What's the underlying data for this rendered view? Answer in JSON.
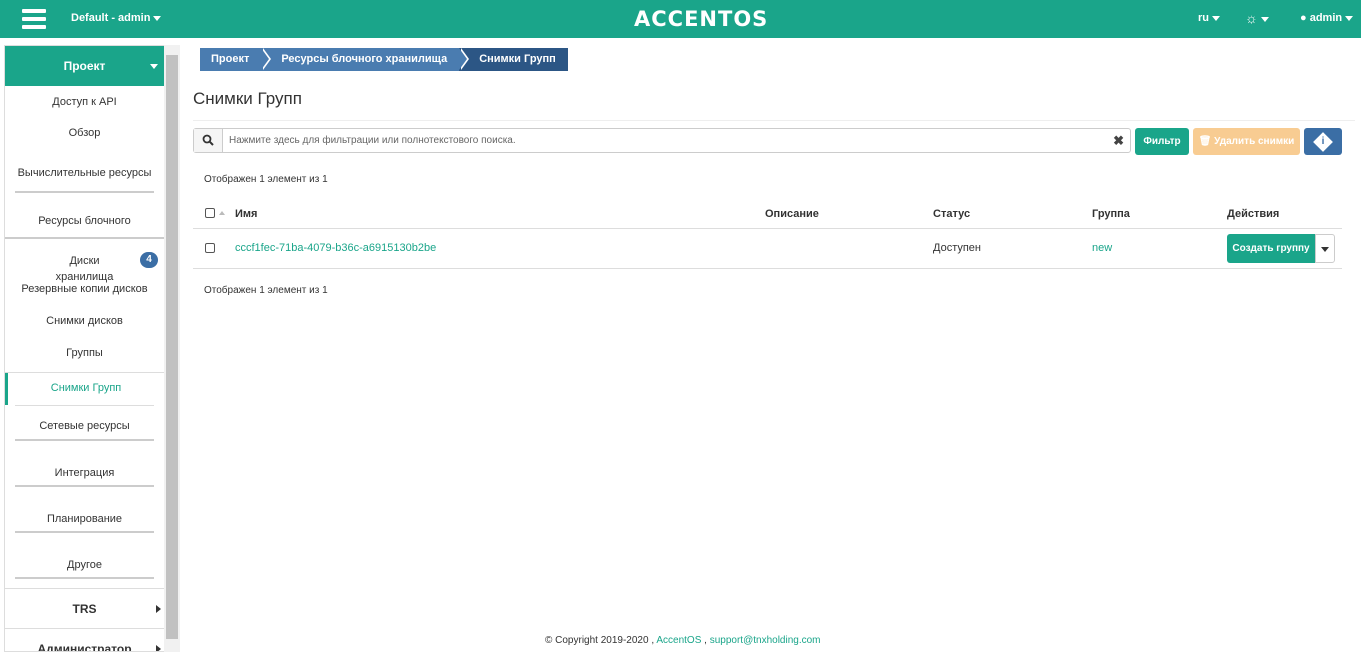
{
  "topbar": {
    "project": "Default - admin",
    "logo": "ACCENTOS",
    "lang": "ru",
    "user": "admin"
  },
  "sidebar": {
    "project_label": "Проект",
    "items": [
      {
        "label": "Доступ к API"
      },
      {
        "label": "Обзор"
      },
      {
        "label": "Вычислительные ресурсы"
      },
      {
        "label": "Ресурсы блочного хранилища"
      },
      {
        "label": "Диски",
        "badge": "4"
      },
      {
        "label": "Резервные копии дисков"
      },
      {
        "label": "Снимки дисков"
      },
      {
        "label": "Группы"
      },
      {
        "label": "Снимки Групп"
      },
      {
        "label": "Сетевые ресурсы"
      },
      {
        "label": "Интеграция"
      },
      {
        "label": "Планирование"
      },
      {
        "label": "Другое"
      }
    ],
    "bottom": [
      "TRS",
      "Администратор"
    ]
  },
  "breadcrumb": [
    "Проект",
    "Ресурсы блочного хранилища",
    "Снимки Групп"
  ],
  "page_title": "Снимки Групп",
  "search": {
    "placeholder": "Нажмите здесь для фильтрации или полнотекстового поиска."
  },
  "buttons": {
    "filter": "Фильтр",
    "delete": "Удалить снимки",
    "create_group": "Создать группу"
  },
  "count_text": "Отображен 1 элемент из 1",
  "table": {
    "columns": [
      "Имя",
      "Описание",
      "Статус",
      "Группа",
      "Действия"
    ],
    "rows": [
      {
        "name": "cccf1fec-71ba-4079-b36c-a6915130b2be",
        "description": "",
        "status": "Доступен",
        "group": "new"
      }
    ]
  },
  "footer": {
    "copyright": "© Copyright 2019-2020 ,",
    "link1": "AccentOS",
    "sep": ",",
    "link2": "support@tnxholding.com"
  },
  "colors": {
    "accent": "#1aa58a",
    "primary": "#3b6ea5",
    "warning_disabled": "#f8cc92"
  }
}
